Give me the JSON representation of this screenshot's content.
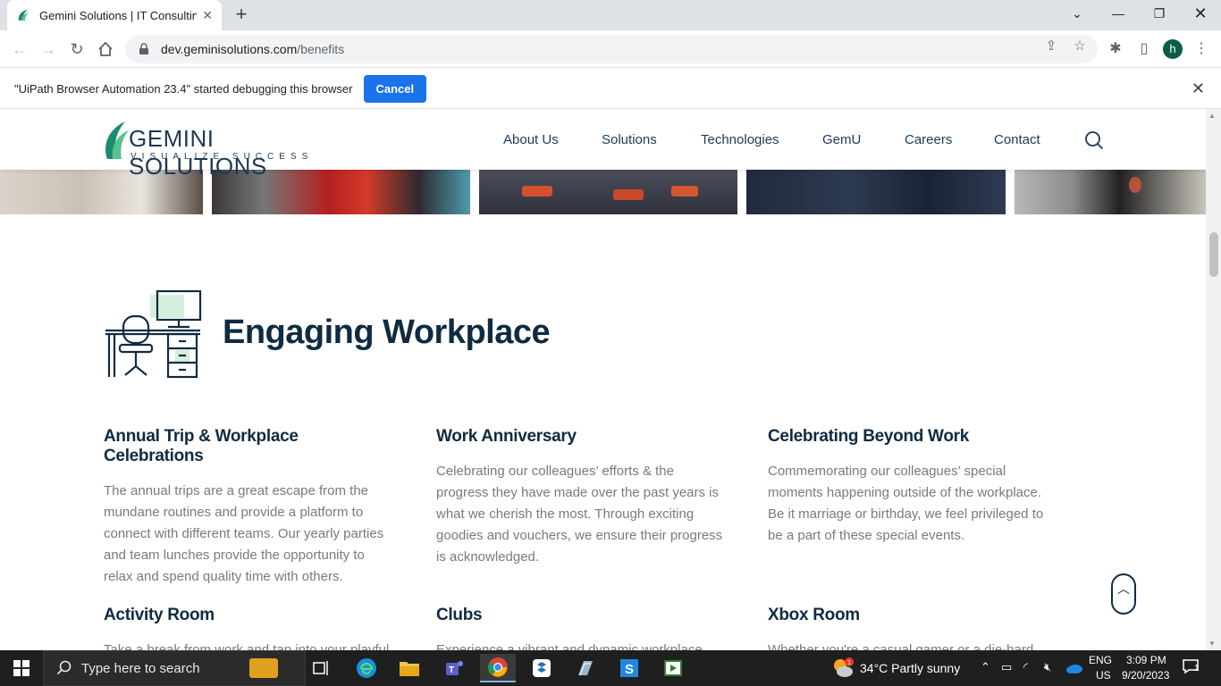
{
  "browser": {
    "tab_title": "Gemini Solutions | IT Consulting",
    "url_domain": "dev.geminisolutions.com",
    "url_path": "/benefits",
    "profile_initial": "h"
  },
  "infobar": {
    "message": "\"UiPath Browser Automation 23.4\" started debugging this browser",
    "cancel_label": "Cancel"
  },
  "site": {
    "logo_name": "GEMINI SOLUTIONS",
    "logo_tagline": "VISUALIZE SUCCESS",
    "menu": [
      "About Us",
      "Solutions",
      "Technologies",
      "GemU",
      "Careers",
      "Contact"
    ]
  },
  "section": {
    "title": "Engaging Workplace",
    "cards": [
      {
        "title": "Annual Trip & Workplace Celebrations",
        "text": "The annual trips are a great escape from the mundane routines and provide a platform to connect with different teams. Our yearly parties and team lunches provide the opportunity to relax and spend quality time with others."
      },
      {
        "title": "Work Anniversary",
        "text": "Celebrating our colleagues’ efforts & the progress they have made over the past years is what we cherish the most. Through exciting goodies and vouchers, we ensure their progress is acknowledged."
      },
      {
        "title": "Celebrating Beyond Work",
        "text": "Commemorating our colleagues’ special moments happening outside of the workplace. Be it marriage or birthday, we feel privileged to be a part of these special events."
      },
      {
        "title": "Activity Room",
        "text": "Take a break from work and tap into your playful"
      },
      {
        "title": "Clubs",
        "text": "Experience a vibrant and dynamic workplace"
      },
      {
        "title": "Xbox Room",
        "text": "Whether you're a casual gamer or a die-hard"
      }
    ]
  },
  "taskbar": {
    "search_placeholder": "Type here to search",
    "weather": "34°C  Partly sunny",
    "lang_top": "ENG",
    "lang_bottom": "US",
    "time": "3:09 PM",
    "date": "9/20/2023",
    "notification_count": "1"
  }
}
